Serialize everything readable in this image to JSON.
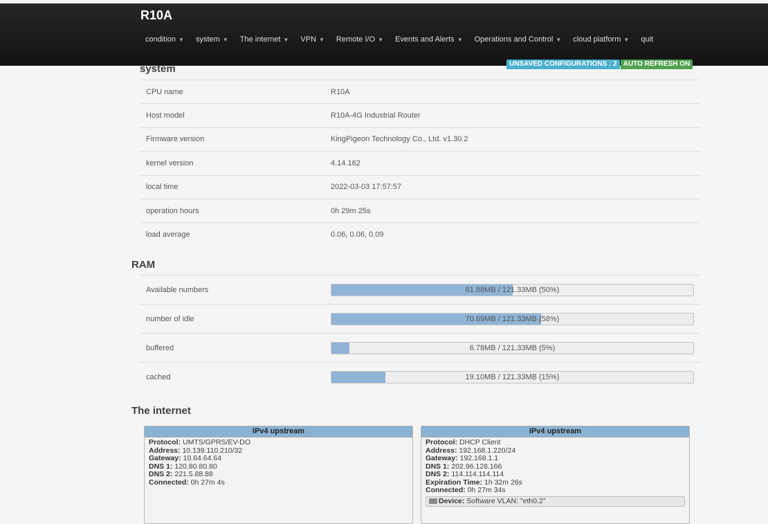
{
  "header": {
    "brand": "R10A",
    "nav": [
      {
        "label": "condition",
        "has_caret": true
      },
      {
        "label": "system",
        "has_caret": true
      },
      {
        "label": "The internet",
        "has_caret": true
      },
      {
        "label": "VPN",
        "has_caret": true
      },
      {
        "label": "Remote I/O",
        "has_caret": true
      },
      {
        "label": "Events and Alerts",
        "has_caret": true
      },
      {
        "label": "Operations and Control",
        "has_caret": true
      },
      {
        "label": "cloud platform",
        "has_caret": true
      },
      {
        "label": "quit",
        "has_caret": false
      }
    ],
    "caret_symbol": "▼",
    "badges": {
      "unsaved": "UNSAVED CONFIGURATIONS : 2",
      "autorefresh": "AUTO REFRESH ON"
    }
  },
  "system": {
    "title": "system",
    "rows": [
      {
        "label": "CPU name",
        "value": "R10A"
      },
      {
        "label": "Host model",
        "value": "R10A-4G Industrial Router"
      },
      {
        "label": "Firmware version",
        "value": "KingPigeon Technology Co., Ltd. v1.30.2"
      },
      {
        "label": "kernel version",
        "value": "4.14.162"
      },
      {
        "label": "local time",
        "value": "2022-03-03 17:57:57"
      },
      {
        "label": "operation hours",
        "value": "0h 29m 25s"
      },
      {
        "label": "load average",
        "value": "0.06, 0.06, 0.09"
      }
    ]
  },
  "ram": {
    "title": "RAM",
    "rows": [
      {
        "label": "Available numbers",
        "text": "61.88MB / 121.33MB (50%)",
        "fraction": 0.5
      },
      {
        "label": "number of idle",
        "text": "70.69MB / 121.33MB (58%)",
        "fraction": 0.58
      },
      {
        "label": "buffered",
        "text": "6.78MB / 121.33MB (5%)",
        "fraction": 0.05
      },
      {
        "label": "cached",
        "text": "19.10MB / 121.33MB (15%)",
        "fraction": 0.15
      }
    ]
  },
  "internet": {
    "title": "The internet",
    "boxes": [
      {
        "header": "IPv4 upstream",
        "fields": [
          {
            "k": "Protocol:",
            "v": "UMTS/GPRS/EV-DO"
          },
          {
            "k": "Address:",
            "v": "10.139.110.210/32"
          },
          {
            "k": "Gateway:",
            "v": "10.64.64.64"
          },
          {
            "k": "DNS 1:",
            "v": "120.80.80.80"
          },
          {
            "k": "DNS 2:",
            "v": "221.5.88.88"
          },
          {
            "k": "Connected:",
            "v": "0h 27m 4s"
          }
        ]
      },
      {
        "header": "IPv4 upstream",
        "fields": [
          {
            "k": "Protocol:",
            "v": "DHCP Client"
          },
          {
            "k": "Address:",
            "v": "192.168.1.220/24"
          },
          {
            "k": "Gateway:",
            "v": "192.168.1.1"
          },
          {
            "k": "DNS 1:",
            "v": "202.96.128.166"
          },
          {
            "k": "DNS 2:",
            "v": "114.114.114.114"
          },
          {
            "k": "Expiration Time:",
            "v": "1h 32m 26s"
          },
          {
            "k": "Connected:",
            "v": "0h 27m 34s"
          }
        ],
        "device": {
          "k": "Device:",
          "v": "Software VLAN: \"eth0.2\""
        }
      }
    ]
  },
  "colors": {
    "topbar": "#1c1c1c",
    "badge_blue": "#49afcd",
    "badge_green": "#51a351",
    "bar_fill": "#8fb4d6",
    "box_header": "#8ab2d3"
  }
}
